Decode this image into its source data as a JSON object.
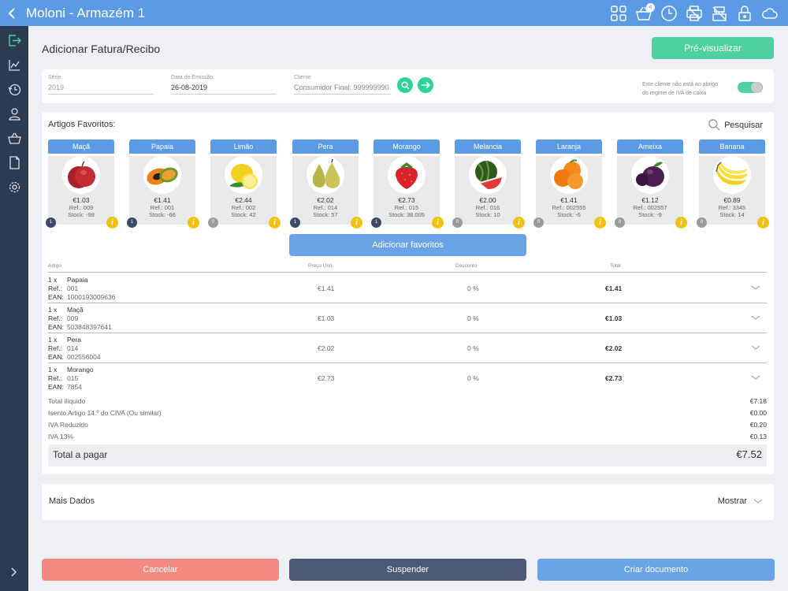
{
  "header": {
    "title": "Moloni - Armazém 1",
    "cart_count": "4"
  },
  "page": {
    "title": "Adicionar Fatura/Recibo",
    "preview_label": "Pré-visualizar"
  },
  "doc": {
    "series_label": "Série",
    "series_value": "2019",
    "date_label": "Data de Emissão",
    "date_value": "26-08-2019",
    "client_label": "Cliente",
    "client_value": "Consumidor Final: 999999990",
    "iva_note_1": "Este cliente não está ao abrigo",
    "iva_note_2": "do regime de IVA de caixa"
  },
  "favorites": {
    "title": "Artigos Favoritos:",
    "search_label": "Pesquisar",
    "add_label": "Adicionar favoritos",
    "items": [
      {
        "name": "Maçã",
        "price": "€1.03",
        "ref": "Ref.: 009",
        "stock": "Stock: -98",
        "qty": "1"
      },
      {
        "name": "Papaia",
        "price": "€1.41",
        "ref": "Ref.: 001",
        "stock": "Stock: -66",
        "qty": "1"
      },
      {
        "name": "Limão",
        "price": "€2.44",
        "ref": "Ref.: 002",
        "stock": "Stock: 42",
        "qty": "0"
      },
      {
        "name": "Pera",
        "price": "€2.02",
        "ref": "Ref.: 014",
        "stock": "Stock: 57",
        "qty": "1"
      },
      {
        "name": "Morango",
        "price": "€2.73",
        "ref": "Ref.: 015",
        "stock": "Stock: 38.005",
        "qty": "1"
      },
      {
        "name": "Melancia",
        "price": "€2.00",
        "ref": "Ref.: 016",
        "stock": "Stock: 10",
        "qty": "0"
      },
      {
        "name": "Laranja",
        "price": "€1.41",
        "ref": "Ref.: 002555",
        "stock": "Stock: -6",
        "qty": "0"
      },
      {
        "name": "Ameixa",
        "price": "€1.12",
        "ref": "Ref.: 002557",
        "stock": "Stock: -9",
        "qty": "0"
      },
      {
        "name": "Banana",
        "price": "€0.89",
        "ref": "Ref.: 3345",
        "stock": "Stock: 14",
        "qty": "0"
      }
    ]
  },
  "table": {
    "col_article": "Artigo",
    "col_price": "Preço Unit.",
    "col_discount": "Desconto",
    "col_total": "Total",
    "ref_label": "Ref.:",
    "ean_label": "EAN:",
    "rows": [
      {
        "qty": "1  x",
        "name": "Papaia",
        "ref": "001",
        "ean": "1000193009636",
        "price": "€1.41",
        "discount": "0 %",
        "total": "€1.41"
      },
      {
        "qty": "1  x",
        "name": "Maçã",
        "ref": "009",
        "ean": "503848397641",
        "price": "€1.03",
        "discount": "0 %",
        "total": "€1.03"
      },
      {
        "qty": "1  x",
        "name": "Pera",
        "ref": "014",
        "ean": "002556004",
        "price": "€2.02",
        "discount": "0 %",
        "total": "€2.02"
      },
      {
        "qty": "1  x",
        "name": "Morango",
        "ref": "015",
        "ean": "7854",
        "price": "€2.73",
        "discount": "0 %",
        "total": "€2.73"
      }
    ]
  },
  "summary": {
    "lines": [
      {
        "label": "Total ilíquido",
        "value": "€7.18"
      },
      {
        "label": "Isento Artigo 14.º do CIVA (Ou similar)",
        "value": "€0.00"
      },
      {
        "label": "IVA Reduzido",
        "value": "€0.20"
      },
      {
        "label": "IVA 13%",
        "value": "€0.13"
      }
    ],
    "total_label": "Total a pagar",
    "total_value": "€7.52"
  },
  "more": {
    "title": "Mais Dados",
    "toggle_label": "Mostrar"
  },
  "footer": {
    "cancel": "Cancelar",
    "suspend": "Suspender",
    "create": "Criar documento"
  },
  "colors": {
    "primary": "#5b9be6",
    "accent": "#4fd0a0",
    "sidebar": "#2d3b51",
    "warning": "#f3c20f",
    "danger": "#f48a82"
  }
}
